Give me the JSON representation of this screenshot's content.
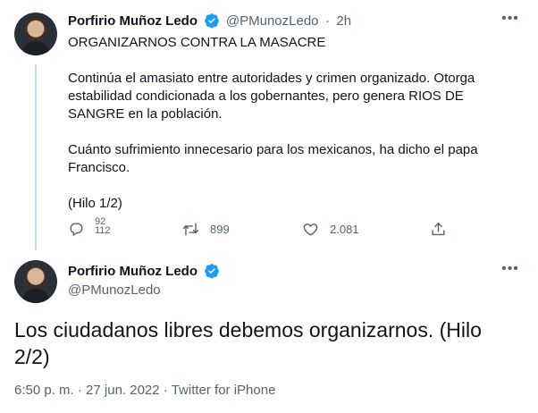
{
  "tweet1": {
    "author_name": "Porfirio Muñoz Ledo",
    "handle": "@PMunozLedo",
    "separator": "·",
    "time_ago": "2h",
    "text": "ORGANIZARNOS CONTRA LA MASACRE\n\nContinúa el amasiato entre autoridades y crimen organizado. Otorga estabilidad condicionada a los gobernantes, pero genera RIOS DE SANGRE en la población.\n\nCuánto sufrimiento innecesario para los mexicanos, ha dicho el papa Francisco.\n\n(Hilo 1/2)",
    "reply_count_top": "92",
    "reply_count_bottom": "112",
    "retweet_count": "899",
    "like_count": "2.081"
  },
  "tweet2": {
    "author_name": "Porfirio Muñoz Ledo",
    "handle": "@PMunozLedo",
    "text": "Los ciudadanos libres debemos organizarnos. (Hilo 2/2)",
    "time": "6:50 p. m.",
    "separator": "·",
    "date": "27 jun. 2022",
    "source": "Twitter for iPhone"
  },
  "icons": {
    "verified": "verified-badge-icon",
    "more": "more-dots-icon",
    "reply": "reply-icon",
    "retweet": "retweet-icon",
    "like": "heart-icon",
    "share": "share-icon"
  },
  "colors": {
    "verified_blue": "#1d9bf0",
    "text_primary": "#0f1419",
    "text_secondary": "#536471",
    "thread_line": "#cfd9de"
  }
}
